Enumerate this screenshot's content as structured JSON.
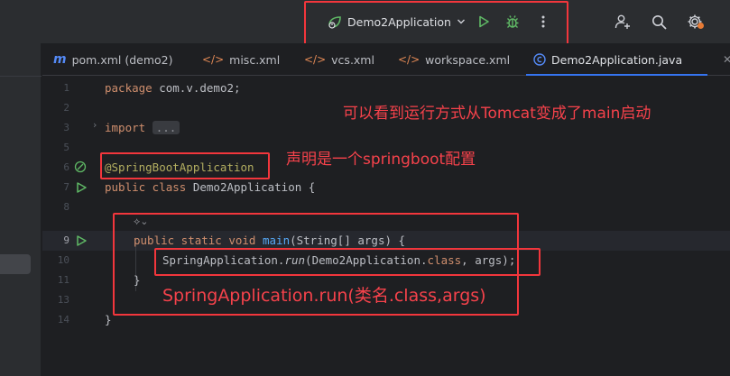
{
  "toolbar": {
    "run_config_label": "Demo2Application",
    "run_icon": "run-icon",
    "debug_icon": "debug-icon",
    "more_icon": "more-vertical-icon",
    "add_user_icon": "add-user-icon",
    "search_icon": "search-icon",
    "settings_icon": "gear-icon"
  },
  "tabs": [
    {
      "label": "pom.xml (demo2)",
      "icon": "m-icon"
    },
    {
      "label": "misc.xml",
      "icon": "xml-icon"
    },
    {
      "label": "vcs.xml",
      "icon": "xml-icon"
    },
    {
      "label": "workspace.xml",
      "icon": "xml-icon"
    },
    {
      "label": "Demo2Application.java",
      "icon": "java-class-icon",
      "active": true
    }
  ],
  "editor": {
    "line_numbers": [
      "1",
      "2",
      "3",
      "5",
      "6",
      "7",
      "8",
      "9",
      "10",
      "11",
      "13",
      "14"
    ],
    "current_line": "9",
    "code": {
      "l1_kw": "package",
      "l1_rest": " com.v.demo2;",
      "l3_kw": "import",
      "l3_fold": "...",
      "l6_annotation": "@SpringBootApplication",
      "l7_kw": "public class",
      "l7_rest": " Demo2Application {",
      "l9_kw": "public static void",
      "l9_fn": "main",
      "l9_rest": "(String[] args) {",
      "l10_a": "SpringApplication.",
      "l10_run": "run",
      "l10_b": "(Demo2Application.",
      "l10_kw": "class",
      "l10_c": ", args);",
      "l11": "}",
      "l13": "}"
    }
  },
  "annotations": {
    "note_top": "可以看到运行方式从Tomcat变成了main启动",
    "note_mid": "声明是一个springboot配置",
    "note_bottom": "SpringApplication.run(类名.class,args)"
  },
  "colors": {
    "annotation_red": "#f2363c",
    "keyword": "#cf8e6d",
    "annotation_code": "#b3ae60",
    "method": "#56a8f5",
    "run_green": "#5fb865",
    "active_tab": "#3574f0"
  }
}
